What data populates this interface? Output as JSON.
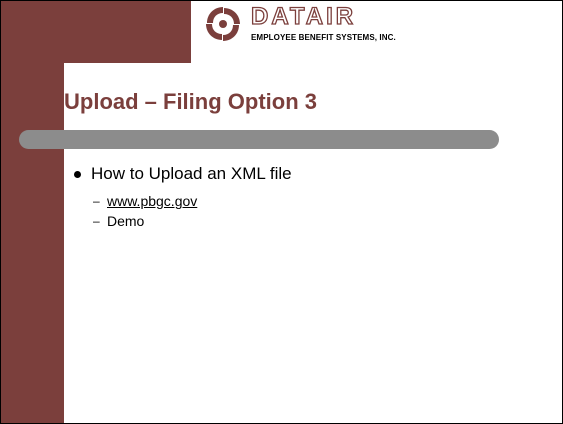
{
  "logo": {
    "icon": "datair-logo-icon",
    "wordmark": "DATAIR",
    "tagline": "EMPLOYEE BENEFIT SYSTEMS, INC."
  },
  "title": "Upload – Filing Option 3",
  "bullets": [
    {
      "text": "How to Upload an XML file"
    }
  ],
  "sub_bullets": [
    {
      "text": "www.pbgc.gov",
      "is_link": true
    },
    {
      "text": "Demo",
      "is_link": false
    }
  ],
  "colors": {
    "accent": "#7b3f3c",
    "divider": "#8c8c8c",
    "background": "#ffffff"
  }
}
